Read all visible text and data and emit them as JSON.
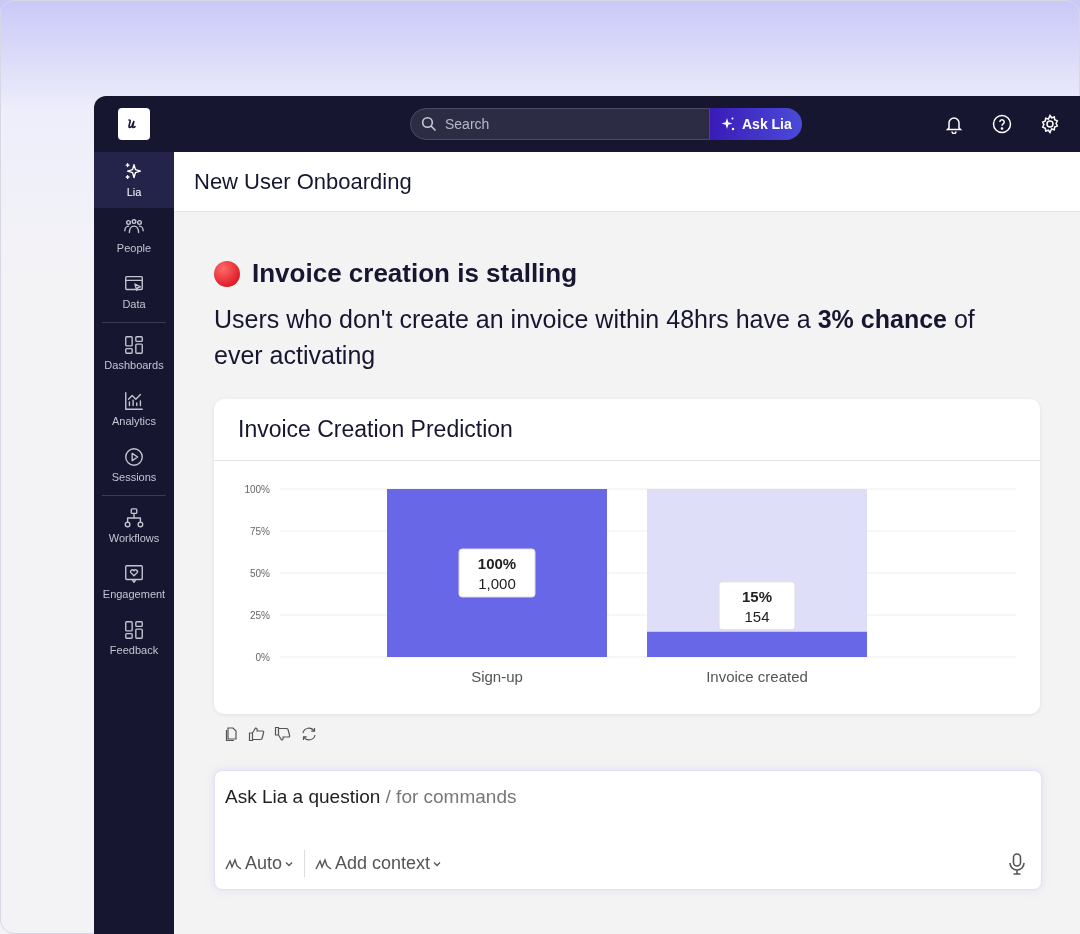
{
  "topbar": {
    "search": {
      "placeholder": "Search"
    },
    "ask_button": "Ask Lia"
  },
  "sidebar": {
    "items": [
      {
        "label": "Lia",
        "selected": true
      },
      {
        "label": "People",
        "selected": false
      },
      {
        "label": "Data",
        "selected": false
      },
      {
        "label": "Dashboards",
        "selected": false
      },
      {
        "label": "Analytics",
        "selected": false
      },
      {
        "label": "Sessions",
        "selected": false
      },
      {
        "label": "Workflows",
        "selected": false
      },
      {
        "label": "Engagement",
        "selected": false
      },
      {
        "label": "Feedback",
        "selected": false
      }
    ]
  },
  "page": {
    "title": "New User Onboarding"
  },
  "insight": {
    "title": "Invoice creation is stalling",
    "text": "Users who don't create an invoice within 48hrs have a **3% chance** of ever activating"
  },
  "chart_card": {
    "title": "Invoice Creation Prediction",
    "chart_data": {
      "type": "bar",
      "categories": [
        "Sign-up",
        "Invoice created"
      ],
      "series": [
        {
          "color": "#6767e7",
          "values": [
            100,
            15
          ]
        }
      ],
      "ylim": [
        0,
        100
      ],
      "grid": true,
      "yticks": [
        {
          "value": 0,
          "label": "0%"
        },
        {
          "value": 25,
          "label": "25%"
        },
        {
          "value": 50,
          "label": "50%"
        },
        {
          "value": 75,
          "label": "75%"
        },
        {
          "value": 100,
          "label": "100%"
        }
      ],
      "value_labels": [
        {
          "percent": "100%",
          "count": "1,000"
        },
        {
          "percent": "15%",
          "count": "154"
        }
      ]
    }
  },
  "prompt": {
    "placeholder": "Ask Lia a question",
    "hint": "/ for commands",
    "mode": "Auto",
    "context": "Add context"
  }
}
